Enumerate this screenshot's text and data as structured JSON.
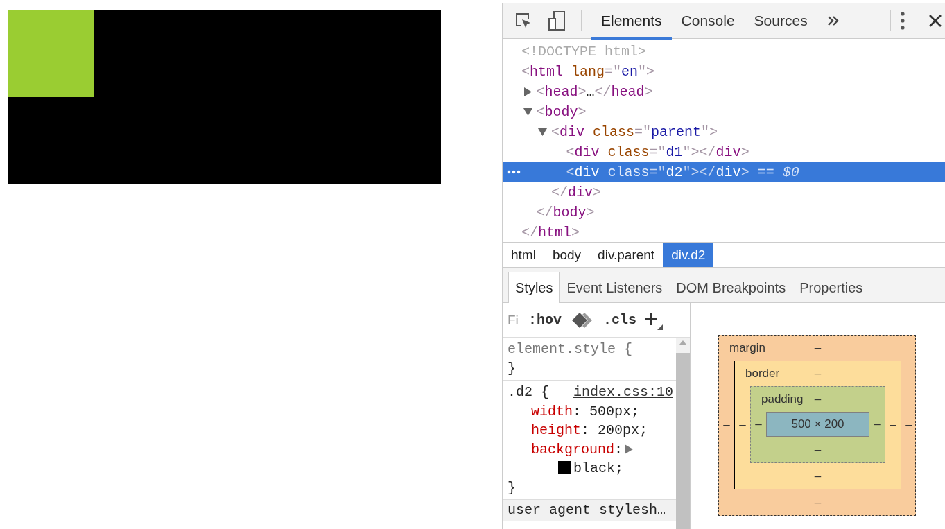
{
  "page": {
    "boxes": [
      {
        "color": "#9acd32"
      },
      {
        "color": "#000000"
      }
    ]
  },
  "devtools": {
    "tabs": [
      {
        "label": "Elements",
        "selected": true
      },
      {
        "label": "Console",
        "selected": false
      },
      {
        "label": "Sources",
        "selected": false
      }
    ],
    "dom_tree": [
      {
        "open": [
          {
            "kind": "doctype",
            "text": "<!DOCTYPE html>"
          }
        ],
        "selected": false
      },
      {
        "open": [
          {
            "kind": "punct",
            "text": "<"
          },
          {
            "kind": "tag",
            "text": "html"
          },
          {
            "kind": "attr",
            "text": " lang"
          },
          {
            "kind": "punct",
            "text": "=\""
          },
          {
            "kind": "value",
            "text": "en"
          },
          {
            "kind": "punct",
            "text": "\">"
          }
        ],
        "close": [
          {
            "kind": "punct",
            "text": "</"
          },
          {
            "kind": "tag",
            "text": "html"
          },
          {
            "kind": "punct",
            "text": ">"
          }
        ],
        "selected": false,
        "children": [
          {
            "open": [
              {
                "kind": "punct",
                "text": "<"
              },
              {
                "kind": "tag",
                "text": "head"
              },
              {
                "kind": "punct",
                "text": ">"
              }
            ],
            "collapsed_text": "…",
            "close": [
              {
                "kind": "punct",
                "text": "</"
              },
              {
                "kind": "tag",
                "text": "head"
              },
              {
                "kind": "punct",
                "text": ">"
              }
            ],
            "expanded": false,
            "selected": false
          },
          {
            "open": [
              {
                "kind": "punct",
                "text": "<"
              },
              {
                "kind": "tag",
                "text": "body"
              },
              {
                "kind": "punct",
                "text": ">"
              }
            ],
            "close": [
              {
                "kind": "punct",
                "text": "</"
              },
              {
                "kind": "tag",
                "text": "body"
              },
              {
                "kind": "punct",
                "text": ">"
              }
            ],
            "expanded": true,
            "selected": false,
            "children": [
              {
                "open": [
                  {
                    "kind": "punct",
                    "text": "<"
                  },
                  {
                    "kind": "tag",
                    "text": "div"
                  },
                  {
                    "kind": "attr",
                    "text": " class"
                  },
                  {
                    "kind": "punct",
                    "text": "=\""
                  },
                  {
                    "kind": "value",
                    "text": "parent"
                  },
                  {
                    "kind": "punct",
                    "text": "\">"
                  }
                ],
                "close": [
                  {
                    "kind": "punct",
                    "text": "</"
                  },
                  {
                    "kind": "tag",
                    "text": "div"
                  },
                  {
                    "kind": "punct",
                    "text": ">"
                  }
                ],
                "expanded": true,
                "selected": false,
                "children": [
                  {
                    "open": [
                      {
                        "kind": "punct",
                        "text": "<"
                      },
                      {
                        "kind": "tag",
                        "text": "div"
                      },
                      {
                        "kind": "attr",
                        "text": " class"
                      },
                      {
                        "kind": "punct",
                        "text": "=\""
                      },
                      {
                        "kind": "value",
                        "text": "d1"
                      },
                      {
                        "kind": "punct",
                        "text": "\">"
                      }
                    ],
                    "close": [
                      {
                        "kind": "punct",
                        "text": "</"
                      },
                      {
                        "kind": "tag",
                        "text": "div"
                      },
                      {
                        "kind": "punct",
                        "text": ">"
                      }
                    ],
                    "selected": false
                  },
                  {
                    "open": [
                      {
                        "kind": "punct",
                        "text": "<"
                      },
                      {
                        "kind": "tag",
                        "text": "div"
                      },
                      {
                        "kind": "attr",
                        "text": " class"
                      },
                      {
                        "kind": "punct",
                        "text": "=\""
                      },
                      {
                        "kind": "value",
                        "text": "d2"
                      },
                      {
                        "kind": "punct",
                        "text": "\">"
                      }
                    ],
                    "close": [
                      {
                        "kind": "punct",
                        "text": "</"
                      },
                      {
                        "kind": "tag",
                        "text": "div"
                      },
                      {
                        "kind": "punct",
                        "text": ">"
                      }
                    ],
                    "selected": true,
                    "suffix": "== $0"
                  }
                ]
              }
            ]
          }
        ]
      }
    ],
    "breadcrumbs": [
      {
        "label": "html",
        "selected": false
      },
      {
        "label": "body",
        "selected": false
      },
      {
        "label": "div.parent",
        "selected": false
      },
      {
        "label": "div.d2",
        "selected": true
      }
    ],
    "subtabs": [
      {
        "label": "Styles",
        "selected": true
      },
      {
        "label": "Event Listeners",
        "selected": false
      },
      {
        "label": "DOM Breakpoints",
        "selected": false
      },
      {
        "label": "Properties",
        "selected": false
      }
    ],
    "styles": {
      "filter": {
        "placeholder": "Fi"
      },
      "hov": ":hov",
      "cls": ".cls",
      "rules": [
        {
          "selector": "element.style",
          "open": "{",
          "close": "}"
        },
        {
          "selector": ".d2",
          "open": "{",
          "source": "index.css:10",
          "close": "}",
          "properties": [
            {
              "name": "width",
              "sep": ":",
              "value": "500px;"
            },
            {
              "name": "height",
              "sep": ":",
              "value": "200px;"
            },
            {
              "name": "background",
              "sep": ":",
              "value": "black;",
              "expandable": true,
              "color": "#000000"
            }
          ]
        }
      ],
      "next_section": "user agent stylesh…"
    },
    "box_model": {
      "layers": [
        {
          "label": "margin",
          "top": "–"
        },
        {
          "label": "border",
          "top": "–"
        },
        {
          "label": "padding",
          "top": "–"
        }
      ],
      "bottom_values": [
        "–",
        "–",
        "–"
      ],
      "left_values": [
        "–",
        "–",
        "–"
      ],
      "right_values": [
        "–",
        "–",
        "–"
      ],
      "content": "500 × 200"
    }
  }
}
